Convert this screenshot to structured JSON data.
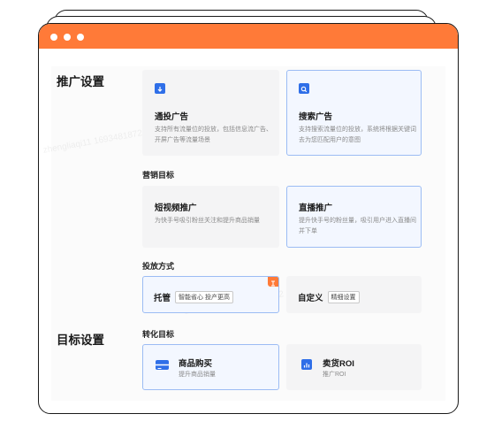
{
  "sections": {
    "promo": "推广设置",
    "goal": "目标设置"
  },
  "promo_type": [
    {
      "title": "通投广告",
      "desc": "支持所有流量位的投放，包括信息流广告、开屏广告等流量场景"
    },
    {
      "title": "搜索广告",
      "desc": "支持搜索流量位的投放，系统将根据关键词去为您匹配用户的意图"
    }
  ],
  "marketing": {
    "label": "营销目标",
    "items": [
      {
        "title": "短视频推广",
        "desc": "为快手号吸引粉丝关注和提升商品销量"
      },
      {
        "title": "直播推广",
        "desc": "提升快手号的粉丝量，吸引用户进入直播间并下单"
      }
    ]
  },
  "delivery": {
    "label": "投放方式",
    "hosted": {
      "title": "托管",
      "tag": "智能省心 投产更高"
    },
    "custom": {
      "title": "自定义",
      "tag": "精细设置"
    }
  },
  "conversion": {
    "label": "转化目标",
    "items": [
      {
        "title": "商品购买",
        "desc": "提升商品销量"
      },
      {
        "title": "卖货ROI",
        "desc": "推广ROI"
      }
    ]
  },
  "watermarks": [
    "zhengliaqi11 1693481872",
    "zhengliaqi11 1693481872",
    "zhengliaqi11 1693481872"
  ],
  "colors": {
    "accent": "#ff7a38",
    "brand": "#2f6fe8",
    "selected_border": "#9cbcf4"
  }
}
